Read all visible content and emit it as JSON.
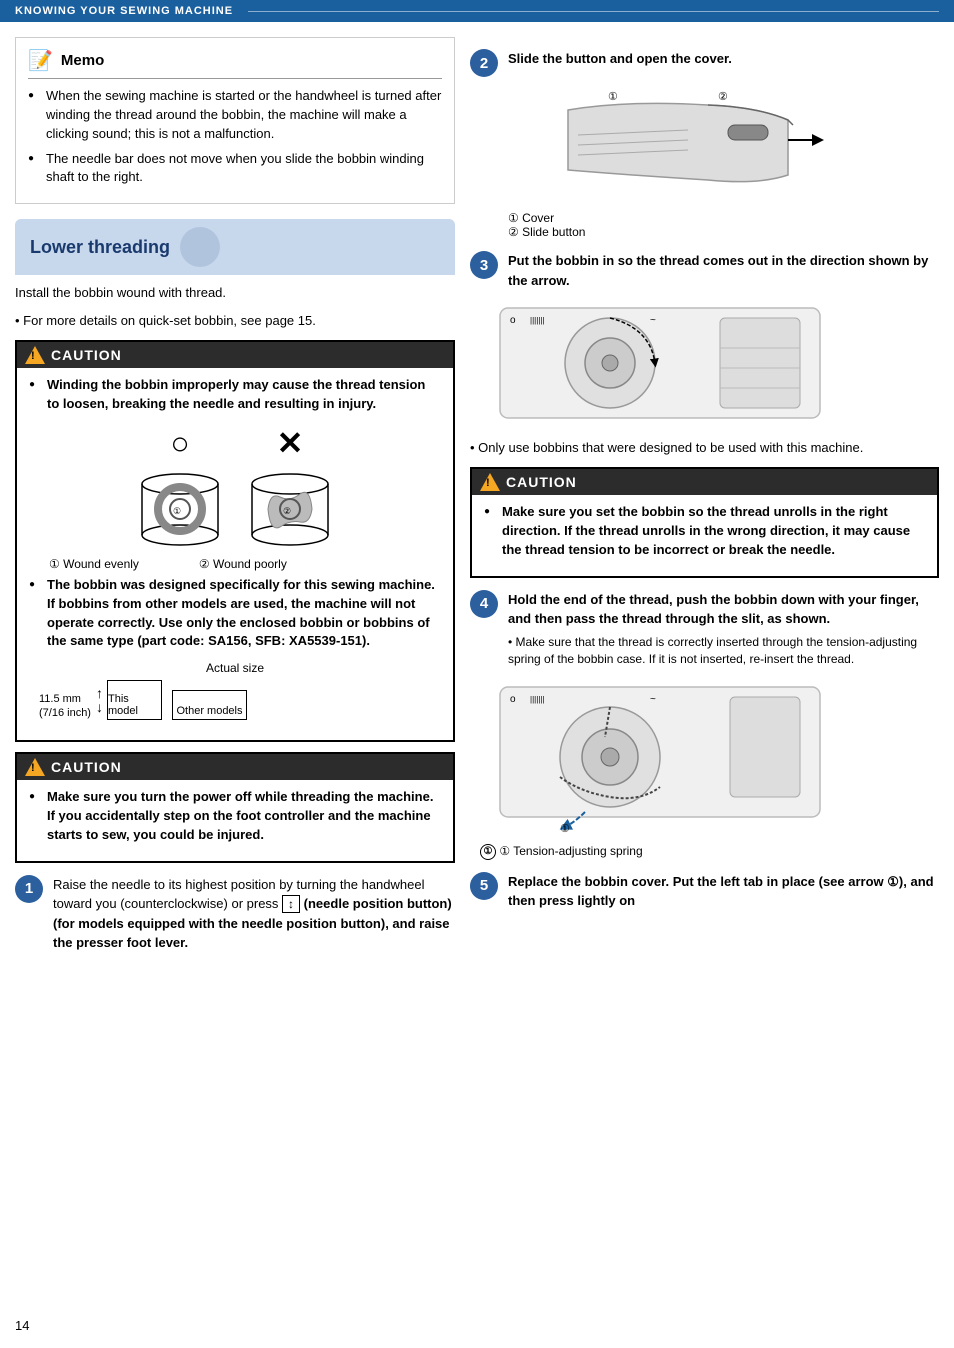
{
  "header": {
    "text": "KNOWING YOUR SEWING MACHINE"
  },
  "memo": {
    "title": "Memo",
    "items": [
      "When the sewing machine is started or the handwheel is turned after winding the thread around the bobbin, the machine will make a clicking sound; this is not a malfunction.",
      "The needle bar does not move when you slide the bobbin winding shaft to the right."
    ]
  },
  "lower_threading": {
    "title": "Lower threading",
    "intro1": "Install the bobbin wound with thread.",
    "intro2": "• For more details on quick-set bobbin, see page 15."
  },
  "caution1": {
    "header": "CAUTION",
    "items": [
      {
        "text": "Winding the bobbin improperly may cause the thread tension to loosen, breaking the needle and resulting in injury."
      },
      {
        "text": "The bobbin was designed specifically for this sewing machine. If bobbins from other models are used, the machine will not operate correctly. Use only the enclosed bobbin or bobbins of the same type (part code: SA156, SFB: XA5539-151)."
      }
    ],
    "diagram_labels": [
      "① Wound evenly",
      "② Wound poorly"
    ],
    "size": {
      "title": "Actual size",
      "dim": "11.5 mm\n(7/16 inch)",
      "this_model": "This model",
      "other_models": "Other models"
    }
  },
  "caution2": {
    "header": "CAUTION",
    "items": [
      {
        "text": "Make sure you turn the power off while threading the machine. If you accidentally step on the foot controller and the machine starts to sew, you could be injured."
      }
    ]
  },
  "step1": {
    "number": "1",
    "text": "Raise the needle to its highest position by turning the handwheel toward you (counterclockwise) or press",
    "button_label": "↕",
    "text2": "(needle position button) (for models equipped with the needle position button), and raise the presser foot lever."
  },
  "step2": {
    "number": "2",
    "text": "Slide the button and open the cover.",
    "labels": [
      "① Cover",
      "② Slide button"
    ]
  },
  "step3": {
    "number": "3",
    "text": "Put the bobbin in so the thread comes out in the direction shown by the arrow.",
    "note": "Only use bobbins that were designed to be used with this machine."
  },
  "caution3": {
    "header": "CAUTION",
    "text": "Make sure you set the bobbin so the thread unrolls in the right direction. If the thread unrolls in the wrong direction, it may cause the thread tension to be incorrect or break the needle."
  },
  "step4": {
    "number": "4",
    "text": "Hold the end of the thread, push the bobbin down with your finger, and then pass the thread through the slit, as shown.",
    "note": "Make sure that the thread is correctly inserted through the tension-adjusting spring of the bobbin case. If it is not inserted, re-insert the thread.",
    "tension_label": "① Tension-adjusting spring"
  },
  "step5": {
    "number": "5",
    "text": "Replace the bobbin cover. Put the left tab in place (see arrow ①), and then press lightly on"
  },
  "page_number": "14"
}
